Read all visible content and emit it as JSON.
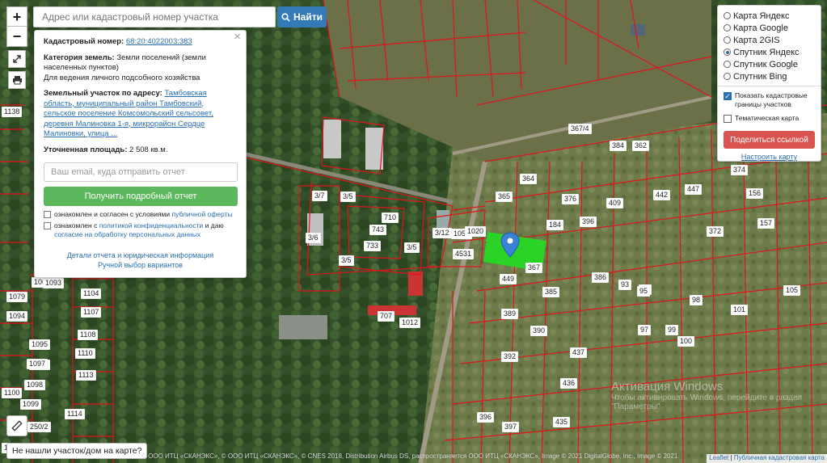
{
  "search": {
    "placeholder": "Адрес или кадастровый номер участка",
    "button_label": "Найти"
  },
  "controls": {
    "zoom_in": "+",
    "zoom_out": "−"
  },
  "info_panel": {
    "cadastral_label": "Кадастровый номер:",
    "cadastral_number": "68:20:4022003:383",
    "category_label": "Категория земель:",
    "category_value": "Земли поселений (земли населенных пунктов)",
    "usage": "Для ведения личного подсобного хозяйства",
    "address_label": "Земельный участок по адресу:",
    "address_value": "Тамбовская область, муниципальный район Тамбовский, сельское поселение Комсомольский сельсовет, деревня Малиновка 1-я, микрорайон Сердце Малиновки, улица ...",
    "area_label": "Уточненная площадь:",
    "area_value": "2 508 кв.м.",
    "email_placeholder": "Ваш email, куда отправить отчет",
    "report_button": "Получить подробный отчет",
    "consent1_text": "ознакомлен и согласен с условиями",
    "consent1_link": "публичной оферты",
    "consent2_text": "ознакомлен с",
    "consent2_link1": "политикой конфиденциальности",
    "consent2_mid": "и даю",
    "consent2_link2": "согласие на обработку персональных данных",
    "details_link": "Детали отчета и юридическая информация",
    "manual_link": "Ручной выбор вариантов"
  },
  "layers": {
    "options": [
      {
        "label": "Карта Яндекс",
        "selected": false
      },
      {
        "label": "Карта Google",
        "selected": false
      },
      {
        "label": "Карта 2GIS",
        "selected": false
      },
      {
        "label": "Спутник Яндекс",
        "selected": true
      },
      {
        "label": "Спутник Google",
        "selected": false
      },
      {
        "label": "Спутник Bing",
        "selected": false
      }
    ],
    "show_borders_label": "Показать кадастровые границы участков",
    "show_borders_checked": true,
    "thematic_label": "Тематическая карта",
    "thematic_checked": false,
    "share_button": "Поделиться ссылкой",
    "setup_link": "Настроить карту"
  },
  "not_found_button": "Не нашли участок/дом на карте?",
  "copyright": "© ООО ИТЦ «СКАНЭКС», © ООО ИТЦ «СКАНЭКС», © CNES 2018, Distribution Airbus DS, распространяется ООО ИТЦ «СКАНЭКС», Image © 2021 DigitalGlobe, Inc., Image © 2021",
  "attribution": {
    "leaflet": "Leaflet",
    "public_map": "Публичная кадастровая карта"
  },
  "watermark": {
    "line1": "Активация Windows",
    "line2": "Чтобы активировать Windows, перейдите в раздел \"Параметры\"."
  },
  "map_labels": {
    "street_label": "367/4",
    "plots": [
      "1138",
      "1065",
      "1079",
      "1104",
      "1094",
      "1107",
      "1095",
      "1108",
      "1096",
      "1110",
      "1097",
      "1100",
      "1098",
      "1099",
      "1113",
      "1114",
      "1093",
      "1103",
      "250/2",
      "3/7",
      "3/5",
      "3/6",
      "3/5",
      "710",
      "743",
      "733",
      "3/5",
      "3/5",
      "3/12",
      "1051",
      "1020",
      "4531",
      "365",
      "364",
      "184",
      "376",
      "396",
      "409",
      "442",
      "447",
      "156",
      "157",
      "374",
      "372",
      "384",
      "386",
      "93",
      "94",
      "98",
      "105",
      "101",
      "392",
      "390",
      "437",
      "436",
      "435",
      "397",
      "396",
      "389",
      "362",
      "367",
      "449",
      "385",
      "99",
      "100",
      "95",
      "97",
      "1011",
      "1012",
      "707",
      "1017"
    ]
  },
  "colors": {
    "parcel_border": "#e0141c",
    "highlight": "#22dd22",
    "marker": "#3b82d6"
  }
}
